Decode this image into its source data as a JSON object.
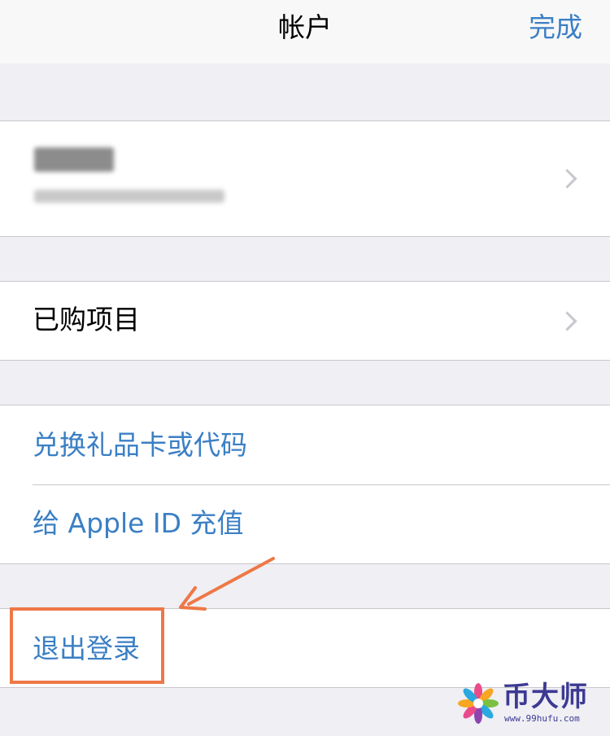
{
  "navbar": {
    "title": "帐户",
    "done_label": "完成"
  },
  "account": {
    "name": "",
    "email": ""
  },
  "purchased": {
    "label": "已购项目"
  },
  "gift": {
    "redeem_label": "兑换礼品卡或代码",
    "topup_label": "给 Apple ID 充值"
  },
  "signout": {
    "label": "退出登录"
  },
  "watermark": {
    "brand": "币大师",
    "url": "www.99hufu.com"
  },
  "colors": {
    "link_blue": "#3b7fc4",
    "highlight_orange": "#ee7846",
    "background": "#efeff4"
  }
}
